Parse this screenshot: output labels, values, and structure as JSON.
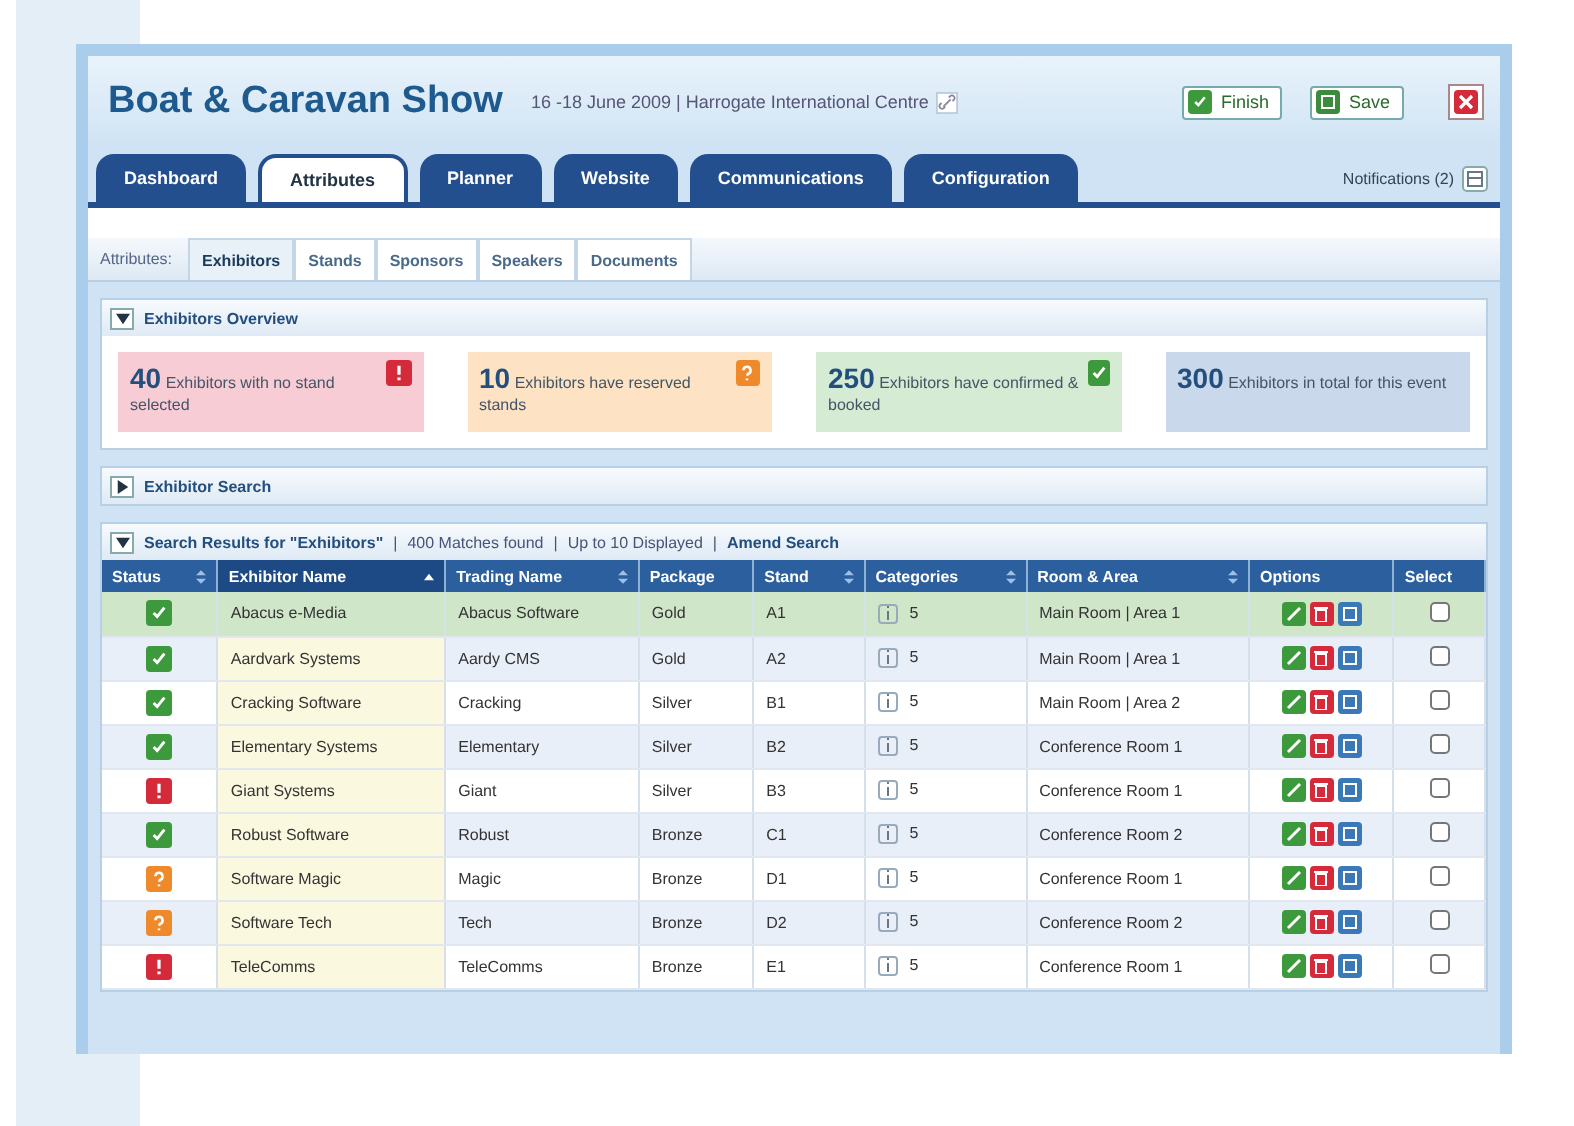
{
  "header": {
    "title": "Boat & Caravan Show",
    "details": "16 -18 June 2009  |  Harrogate International Centre",
    "buttons": [
      {
        "label": "Finish",
        "kind": "finish"
      },
      {
        "label": "Save",
        "kind": "save"
      }
    ]
  },
  "main_tabs": [
    {
      "label": "Dashboard",
      "selected": false
    },
    {
      "label": "Attributes",
      "selected": true
    },
    {
      "label": "Planner",
      "selected": false
    },
    {
      "label": "Website",
      "selected": false
    },
    {
      "label": "Communications",
      "selected": false
    },
    {
      "label": "Configuration",
      "selected": false
    }
  ],
  "notifications": "Notifications (2)",
  "sub_tabs": {
    "label": "Attributes:",
    "items": [
      {
        "label": "Exhibitors",
        "selected": true
      },
      {
        "label": "Stands",
        "selected": false
      },
      {
        "label": "Sponsors",
        "selected": false
      },
      {
        "label": "Speakers",
        "selected": false
      },
      {
        "label": "Documents",
        "selected": false
      }
    ]
  },
  "overview": {
    "title": "Exhibitors Overview",
    "expanded": true,
    "cards": [
      {
        "kind": "alert",
        "count": "40",
        "text": "Exhibitors with no stand selected"
      },
      {
        "kind": "warn",
        "count": "10",
        "text": "Exhibitors have reserved stands"
      },
      {
        "kind": "ok",
        "count": "250",
        "text": "Exhibitors have confirmed & booked"
      },
      {
        "kind": "total",
        "count": "300",
        "text": "Exhibitors in total for this event"
      }
    ]
  },
  "search": {
    "title": "Exhibitor Search",
    "expanded": false
  },
  "results": {
    "title": "Search Results for \"Exhibitors\"",
    "meta": [
      "|",
      "400 Matches found",
      "|",
      "Up to 10 Displayed",
      "|"
    ],
    "amend": "Amend Search",
    "expanded": true,
    "columns": [
      {
        "label": "Status",
        "sortable": true,
        "sorted": false
      },
      {
        "label": "Exhibitor Name",
        "sortable": true,
        "sorted": true
      },
      {
        "label": "Trading Name",
        "sortable": true,
        "sorted": false
      },
      {
        "label": "Package",
        "sortable": false,
        "sorted": false
      },
      {
        "label": "Stand",
        "sortable": true,
        "sorted": false
      },
      {
        "label": "Categories",
        "sortable": true,
        "sorted": false
      },
      {
        "label": "Room & Area",
        "sortable": true,
        "sorted": false
      },
      {
        "label": "Options",
        "sortable": false,
        "sorted": false
      },
      {
        "label": "Select",
        "sortable": false,
        "sorted": false
      }
    ],
    "rows": [
      {
        "kind": "ok",
        "name": "Abacus e-Media",
        "trading": "Abacus Software",
        "package": "Gold",
        "stand": "A1",
        "categories": "5",
        "room": "Main Room | Area 1",
        "selected": true,
        "checked": false
      },
      {
        "kind": "ok",
        "name": "Aardvark Systems",
        "trading": "Aardy CMS",
        "package": "Gold",
        "stand": "A2",
        "categories": "5",
        "room": "Main Room | Area 1",
        "selected": false,
        "checked": false
      },
      {
        "kind": "ok",
        "name": "Cracking Software",
        "trading": "Cracking",
        "package": "Silver",
        "stand": "B1",
        "categories": "5",
        "room": "Main Room | Area 2",
        "selected": false,
        "checked": false
      },
      {
        "kind": "ok",
        "name": "Elementary Systems",
        "trading": "Elementary",
        "package": "Silver",
        "stand": "B2",
        "categories": "5",
        "room": "Conference Room 1",
        "selected": false,
        "checked": false
      },
      {
        "kind": "alert",
        "name": "Giant Systems",
        "trading": "Giant",
        "package": "Silver",
        "stand": "B3",
        "categories": "5",
        "room": "Conference Room 1",
        "selected": false,
        "checked": false
      },
      {
        "kind": "ok",
        "name": "Robust Software",
        "trading": "Robust",
        "package": "Bronze",
        "stand": "C1",
        "categories": "5",
        "room": "Conference Room 2",
        "selected": false,
        "checked": false
      },
      {
        "kind": "warn",
        "name": "Software Magic",
        "trading": "Magic",
        "package": "Bronze",
        "stand": "D1",
        "categories": "5",
        "room": "Conference Room 1",
        "selected": false,
        "checked": false
      },
      {
        "kind": "warn",
        "name": "Software Tech",
        "trading": "Tech",
        "package": "Bronze",
        "stand": "D2",
        "categories": "5",
        "room": "Conference Room 2",
        "selected": false,
        "checked": false
      },
      {
        "kind": "alert",
        "name": "TeleComms",
        "trading": "TeleComms",
        "package": "Bronze",
        "stand": "E1",
        "categories": "5",
        "room": "Conference Room 1",
        "selected": false,
        "checked": false
      }
    ]
  }
}
